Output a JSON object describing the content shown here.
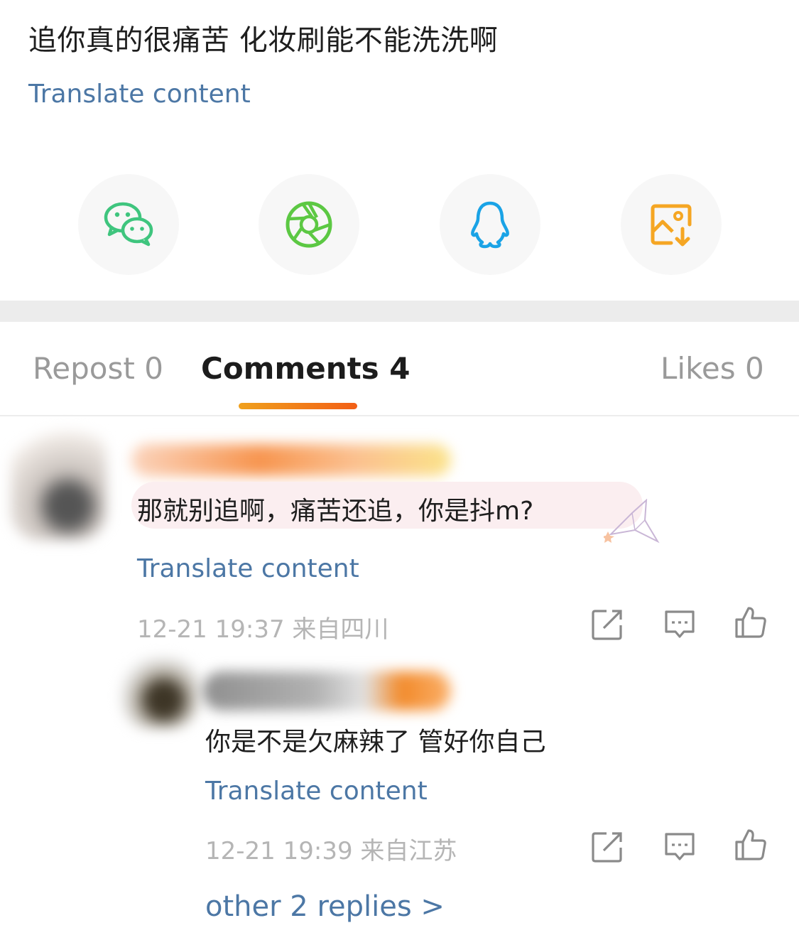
{
  "post": {
    "text": "追你真的很痛苦 化妆刷能不能洗洗啊",
    "translate_label": "Translate content"
  },
  "share": [
    {
      "icon": "wechat-icon",
      "color": "#3fc57e"
    },
    {
      "icon": "moments-icon",
      "color": "#5cc843"
    },
    {
      "icon": "qq-icon",
      "color": "#1aa3e6"
    },
    {
      "icon": "save-image-icon",
      "color": "#f5a623"
    }
  ],
  "tabs": {
    "repost": "Repost 0",
    "comments": "Comments 4",
    "likes": "Likes 0"
  },
  "comments": [
    {
      "text": "那就别追啊，痛苦还追，你是抖m?",
      "translate_label": "Translate content",
      "time": "12-21 19:37",
      "location": "来自四川"
    },
    {
      "text": "你是不是欠麻辣了 管好你自己",
      "translate_label": "Translate content",
      "time": "12-21 19:39",
      "location": "来自江苏"
    }
  ],
  "more_replies": "other 2 replies >",
  "colors": {
    "link": "#4c77a5",
    "accent": "#f27a1a"
  }
}
